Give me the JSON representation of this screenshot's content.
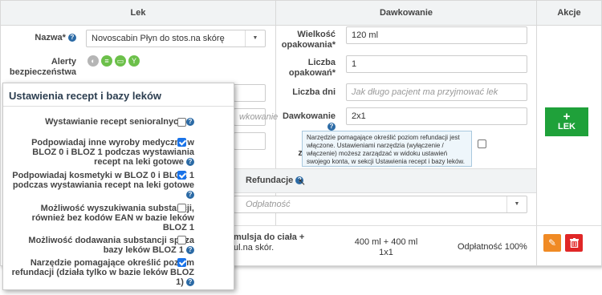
{
  "headers": {
    "lek": "Lek",
    "dawkowanie": "Dawkowanie",
    "akcje": "Akcje"
  },
  "nazwa": {
    "label": "Nazwa*",
    "value": "Novoscabin Płyn do stos.na skórę"
  },
  "alerty_label": "Alerty bezpieczeństwa",
  "wielkosc": {
    "label": "Wielkość opakowania*",
    "value": "120 ml"
  },
  "liczba_opak": {
    "label": "Liczba opakowań*",
    "value": "1"
  },
  "liczba_dni": {
    "label": "Liczba dni",
    "placeholder": "Jak długo pacjent ma przyjmować lek"
  },
  "dawkowanie": {
    "label": "Dawkowanie",
    "value": "2x1"
  },
  "hidden_field_fragment": "wkowanie",
  "partial_label": "za",
  "lek_button": "LEK",
  "lek_button_plus": "+",
  "refundacje": {
    "label": "Refundacje",
    "value": "Odpłatność"
  },
  "tooltip": "Narzędzie pomagające określić poziom refundacji jest włączone. Ustawieniami narzędzia (wyłączenie / włączenie) możesz zarządzać w widoku ustawień swojego konta, w sekcji Ustawienia recept i bazy leków.",
  "list_row": {
    "name_line1": "mulsja do ciała +",
    "name_line2": "ul.na skór.",
    "qty_line1": "400 ml + 400 ml",
    "qty_line2": "1x1",
    "odplatnosc": "Odpłatność 100%"
  },
  "settings": {
    "title": "Ustawienia recept i bazy leków",
    "items": [
      {
        "label": "Wystawianie recept senioralnych",
        "checked": false
      },
      {
        "label": "Podpowiadaj inne wyroby medyczne w BLOZ 0 i BLOZ 1 podczas wystawiania recept na leki gotowe",
        "checked": true
      },
      {
        "label": "Podpowiadaj kosmetyki w BLOZ 0 i BLOZ 1 podczas wystawiania recept na leki gotowe",
        "checked": true
      },
      {
        "label": "Możliwość wyszukiwania substancji, również bez kodów EAN w bazie leków BLOZ 1",
        "checked": false
      },
      {
        "label": "Możliwość dodawania substancji spoza bazy leków BLOZ 1",
        "checked": false
      },
      {
        "label": "Narzędzie pomagające określić poziom refundacji (działa tylko w bazie leków BLOZ 1)",
        "checked": true
      }
    ]
  },
  "colors": {
    "help": "#2b6aa5",
    "green": "#1fa13a",
    "orange": "#f08a24",
    "red": "#e02727",
    "checkbox": "#1a73e8"
  }
}
